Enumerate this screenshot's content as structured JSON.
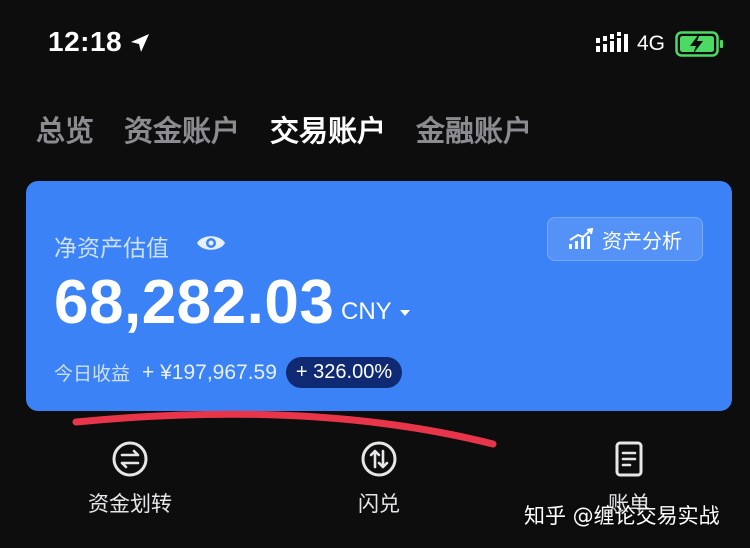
{
  "status_bar": {
    "time": "12:18",
    "location_icon": "location-arrow-icon",
    "signal_icon": "cellular-signal-icon",
    "network": "4G",
    "battery_icon": "battery-charging-icon",
    "battery_color": "#4cd964"
  },
  "tabs": [
    {
      "label": "总览",
      "active": false
    },
    {
      "label": "资金账户",
      "active": false
    },
    {
      "label": "交易账户",
      "active": true
    },
    {
      "label": "金融账户",
      "active": false
    }
  ],
  "card": {
    "background": "#3b82f6",
    "net_asset_label": "净资产估值",
    "eye_icon": "eye-icon",
    "analysis_button": {
      "icon": "chart-analysis-icon",
      "label": "资产分析"
    },
    "amount": "68,282.03",
    "currency": "CNY",
    "today_label": "今日收益",
    "today_value": "+ ¥197,967.59",
    "today_percent": "+ 326.00%",
    "percent_badge_color": "#0f2a73"
  },
  "annotation_color": "#e8354a",
  "actions": [
    {
      "label": "资金划转",
      "icon": "transfer-icon"
    },
    {
      "label": "闪兑",
      "icon": "swap-icon"
    },
    {
      "label": "账单",
      "icon": "bill-icon"
    }
  ],
  "watermark": "知乎 @缠论交易实战"
}
